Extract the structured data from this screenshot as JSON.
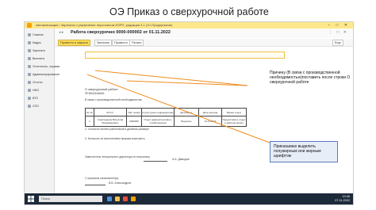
{
  "slide": {
    "title": "ОЭ Приказ о сверхурочной работе"
  },
  "app": {
    "title": "Автоматизация / Зарплата и управление персоналом КОРП, редакция 3.1 (1С:Предприятие)"
  },
  "sidebar": {
    "items": [
      {
        "label": "Главное"
      },
      {
        "label": "Кадры"
      },
      {
        "label": "Зарплата"
      },
      {
        "label": "Выплаты"
      },
      {
        "label": "Отчетность, справки"
      },
      {
        "label": "Администрирование"
      },
      {
        "label": "Отчеты"
      },
      {
        "label": "НФО"
      },
      {
        "label": "ВТО"
      },
      {
        "label": "СПО"
      }
    ]
  },
  "document": {
    "title": "Работа сверхурочно 0000-000002 от 01.11.2022",
    "toolbar": {
      "post_close": "Провести и закрыть",
      "save": "Записать",
      "post": "Провести",
      "print": "Печать",
      "more": "Еще"
    },
    "heading": "О сверхурочной работе",
    "order_label": "ПРИКАЗЫВАЮ:",
    "reason_line": "В связи с производственной необходимостью",
    "table": {
      "headers": [
        "№ п/п",
        "Ф.И.О.",
        "Таб. номер",
        "Структурное подразделение",
        "Должность",
        "Даты выхода",
        "Время отдых"
      ],
      "row": [
        "1",
        "Александров Вячеслав Владимирович",
        "0000000",
        "Отдел административно-хозяйственный",
        "Водитель",
        "13.11.2022",
        "Предоставить отдых в рабочие время"
      ]
    },
    "para2": "2. Согласно оплате работников в двойном размере",
    "para3": "3. Контроль за исполнением приказа возложить",
    "signer_role": "Заместитель генерального директора по персоналу",
    "signer_name": "А.А. Давыдов",
    "acquainted": "С приказом ознакомлен(а):",
    "employee_name": "В.В. Александров"
  },
  "annotations": {
    "reason": "Причину (В связи с производственной необходимостью)поставить после строки О сверхурочной работе",
    "bold": "Приказываю выделить полужирным или жирным шрифтом"
  },
  "taskbar": {
    "search_placeholder": "Поиск",
    "time": "10:46",
    "date": "07.11.2022"
  },
  "colors": {
    "accent": "#ffdd57",
    "arrow": "#f08c1e",
    "taskbar": "#1d2a3a"
  }
}
